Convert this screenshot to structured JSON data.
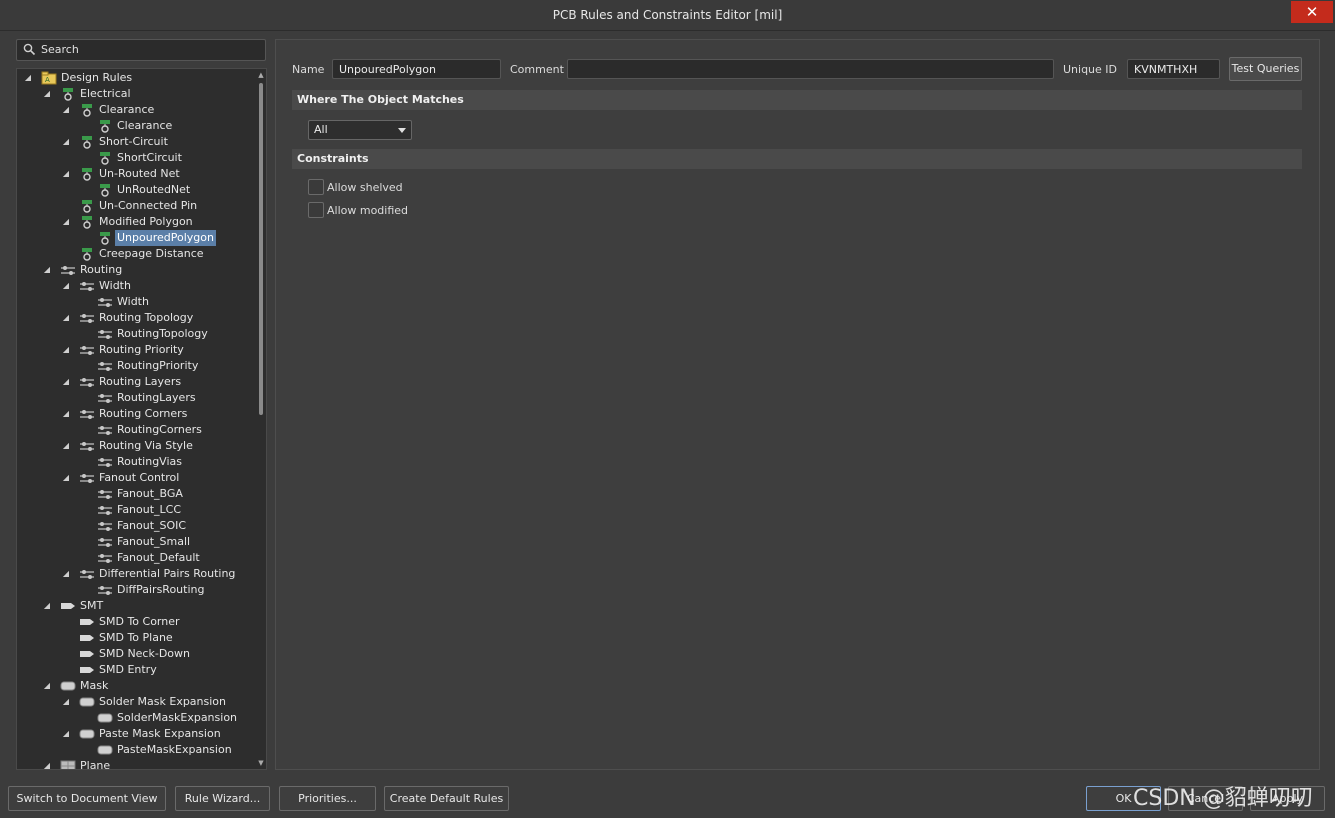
{
  "window": {
    "title": "PCB Rules and Constraints Editor [mil]",
    "close_label": "✕"
  },
  "search": {
    "label": "Search"
  },
  "tree": [
    {
      "label": "Design Rules",
      "level": 0,
      "expanded": true,
      "icon": "design-rules"
    },
    {
      "label": "Electrical",
      "level": 1,
      "expanded": true,
      "icon": "electrical"
    },
    {
      "label": "Clearance",
      "level": 2,
      "expanded": true,
      "icon": "electrical"
    },
    {
      "label": "Clearance",
      "level": 3,
      "icon": "electrical"
    },
    {
      "label": "Short-Circuit",
      "level": 2,
      "expanded": true,
      "icon": "electrical"
    },
    {
      "label": "ShortCircuit",
      "level": 3,
      "icon": "electrical"
    },
    {
      "label": "Un-Routed Net",
      "level": 2,
      "expanded": true,
      "icon": "electrical"
    },
    {
      "label": "UnRoutedNet",
      "level": 3,
      "icon": "electrical"
    },
    {
      "label": "Un-Connected Pin",
      "level": 2,
      "icon": "electrical"
    },
    {
      "label": "Modified Polygon",
      "level": 2,
      "expanded": true,
      "icon": "electrical"
    },
    {
      "label": "UnpouredPolygon",
      "level": 3,
      "icon": "electrical",
      "selected": true
    },
    {
      "label": "Creepage Distance",
      "level": 2,
      "icon": "electrical"
    },
    {
      "label": "Routing",
      "level": 1,
      "expanded": true,
      "icon": "routing"
    },
    {
      "label": "Width",
      "level": 2,
      "expanded": true,
      "icon": "routing"
    },
    {
      "label": "Width",
      "level": 3,
      "icon": "routing"
    },
    {
      "label": "Routing Topology",
      "level": 2,
      "expanded": true,
      "icon": "routing"
    },
    {
      "label": "RoutingTopology",
      "level": 3,
      "icon": "routing"
    },
    {
      "label": "Routing Priority",
      "level": 2,
      "expanded": true,
      "icon": "routing"
    },
    {
      "label": "RoutingPriority",
      "level": 3,
      "icon": "routing"
    },
    {
      "label": "Routing Layers",
      "level": 2,
      "expanded": true,
      "icon": "routing"
    },
    {
      "label": "RoutingLayers",
      "level": 3,
      "icon": "routing"
    },
    {
      "label": "Routing Corners",
      "level": 2,
      "expanded": true,
      "icon": "routing"
    },
    {
      "label": "RoutingCorners",
      "level": 3,
      "icon": "routing"
    },
    {
      "label": "Routing Via Style",
      "level": 2,
      "expanded": true,
      "icon": "routing"
    },
    {
      "label": "RoutingVias",
      "level": 3,
      "icon": "routing"
    },
    {
      "label": "Fanout Control",
      "level": 2,
      "expanded": true,
      "icon": "routing"
    },
    {
      "label": "Fanout_BGA",
      "level": 3,
      "icon": "routing"
    },
    {
      "label": "Fanout_LCC",
      "level": 3,
      "icon": "routing"
    },
    {
      "label": "Fanout_SOIC",
      "level": 3,
      "icon": "routing"
    },
    {
      "label": "Fanout_Small",
      "level": 3,
      "icon": "routing"
    },
    {
      "label": "Fanout_Default",
      "level": 3,
      "icon": "routing"
    },
    {
      "label": "Differential Pairs Routing",
      "level": 2,
      "expanded": true,
      "icon": "routing"
    },
    {
      "label": "DiffPairsRouting",
      "level": 3,
      "icon": "routing"
    },
    {
      "label": "SMT",
      "level": 1,
      "expanded": true,
      "icon": "smt"
    },
    {
      "label": "SMD To Corner",
      "level": 2,
      "icon": "smt"
    },
    {
      "label": "SMD To Plane",
      "level": 2,
      "icon": "smt"
    },
    {
      "label": "SMD Neck-Down",
      "level": 2,
      "icon": "smt"
    },
    {
      "label": "SMD Entry",
      "level": 2,
      "icon": "smt"
    },
    {
      "label": "Mask",
      "level": 1,
      "expanded": true,
      "icon": "mask"
    },
    {
      "label": "Solder Mask Expansion",
      "level": 2,
      "expanded": true,
      "icon": "mask"
    },
    {
      "label": "SolderMaskExpansion",
      "level": 3,
      "icon": "mask"
    },
    {
      "label": "Paste Mask Expansion",
      "level": 2,
      "expanded": true,
      "icon": "mask"
    },
    {
      "label": "PasteMaskExpansion",
      "level": 3,
      "icon": "mask"
    },
    {
      "label": "Plane",
      "level": 1,
      "expanded": true,
      "icon": "plane"
    }
  ],
  "rule": {
    "name_label": "Name",
    "name_value": "UnpouredPolygon",
    "comment_label": "Comment",
    "comment_value": "",
    "uid_label": "Unique ID",
    "uid_value": "KVNMTHXH",
    "test_queries_label": "Test Queries"
  },
  "where": {
    "header": "Where The Object Matches",
    "selected": "All"
  },
  "constraints": {
    "header": "Constraints",
    "allow_shelved": {
      "label": "Allow shelved",
      "checked": false
    },
    "allow_modified": {
      "label": "Allow modified",
      "checked": false
    }
  },
  "footer": {
    "switch_view": "Switch to Document View",
    "rule_wizard": "Rule Wizard...",
    "priorities": "Priorities...",
    "create_default": "Create Default Rules",
    "ok": "OK",
    "cancel": "Cancel",
    "apply": "Apply"
  },
  "watermark": "CSDN @貂蝉叨叨",
  "colors": {
    "selection": "#5b7fa8",
    "close": "#c42b1c"
  }
}
